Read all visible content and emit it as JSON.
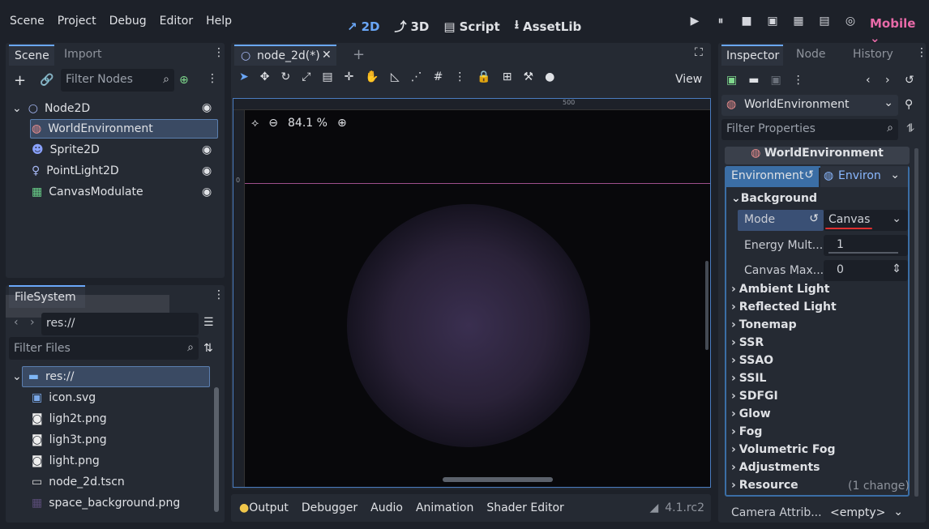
{
  "menu": [
    "Scene",
    "Project",
    "Debug",
    "Editor",
    "Help"
  ],
  "workspaces": [
    {
      "label": "2D",
      "icon": "2d-icon",
      "active": true
    },
    {
      "label": "3D",
      "icon": "3d-icon",
      "active": false
    },
    {
      "label": "Script",
      "icon": "script-icon",
      "active": false
    },
    {
      "label": "AssetLib",
      "icon": "assetlib-icon",
      "active": false
    }
  ],
  "renderer": "Mobile",
  "scene_panel": {
    "tabs": [
      "Scene",
      "Import"
    ],
    "filter_placeholder": "Filter Nodes",
    "nodes": [
      {
        "label": "Node2D",
        "icon": "node2d-icon",
        "visible_toggle": true
      },
      {
        "label": "WorldEnvironment",
        "icon": "world-environment-icon",
        "selected": true,
        "visible_toggle": false
      },
      {
        "label": "Sprite2D",
        "icon": "sprite2d-icon",
        "visible_toggle": true
      },
      {
        "label": "PointLight2D",
        "icon": "pointlight2d-icon",
        "visible_toggle": true
      },
      {
        "label": "CanvasModulate",
        "icon": "canvasmodulate-icon",
        "visible_toggle": true
      }
    ]
  },
  "filesystem": {
    "title": "FileSystem",
    "path": "res://",
    "filter_placeholder": "Filter Files",
    "root": "res://",
    "files": [
      "icon.svg",
      "ligh2t.png",
      "ligh3t.png",
      "light.png",
      "node_2d.tscn",
      "space_background.png"
    ]
  },
  "viewport": {
    "tab": "node_2d(*)",
    "zoom": "84.1 %",
    "ruler_mark": "500",
    "view_label": "View",
    "ruler_zero": "0"
  },
  "inspector": {
    "tabs": [
      "Inspector",
      "Node",
      "History"
    ],
    "object": "WorldEnvironment",
    "filter_placeholder": "Filter Properties",
    "resource_header": "WorldEnvironment",
    "property_label": "Environment",
    "property_value": "Environ",
    "background_section": "Background",
    "mode_label": "Mode",
    "mode_value": "Canvas",
    "energy_label": "Energy Mult...",
    "energy_value": "1",
    "canvas_max_label": "Canvas Max...",
    "canvas_max_value": "0",
    "sections": [
      "Ambient Light",
      "Reflected Light",
      "Tonemap",
      "SSR",
      "SSAO",
      "SSIL",
      "SDFGI",
      "Glow",
      "Fog",
      "Volumetric Fog",
      "Adjustments",
      "Resource"
    ],
    "resource_change": "(1 change)",
    "camera_label": "Camera Attrib...",
    "camera_value": "<empty>"
  },
  "bottom_tabs": [
    "Output",
    "Debugger",
    "Audio",
    "Animation",
    "Shader Editor"
  ],
  "version": "4.1.rc2"
}
